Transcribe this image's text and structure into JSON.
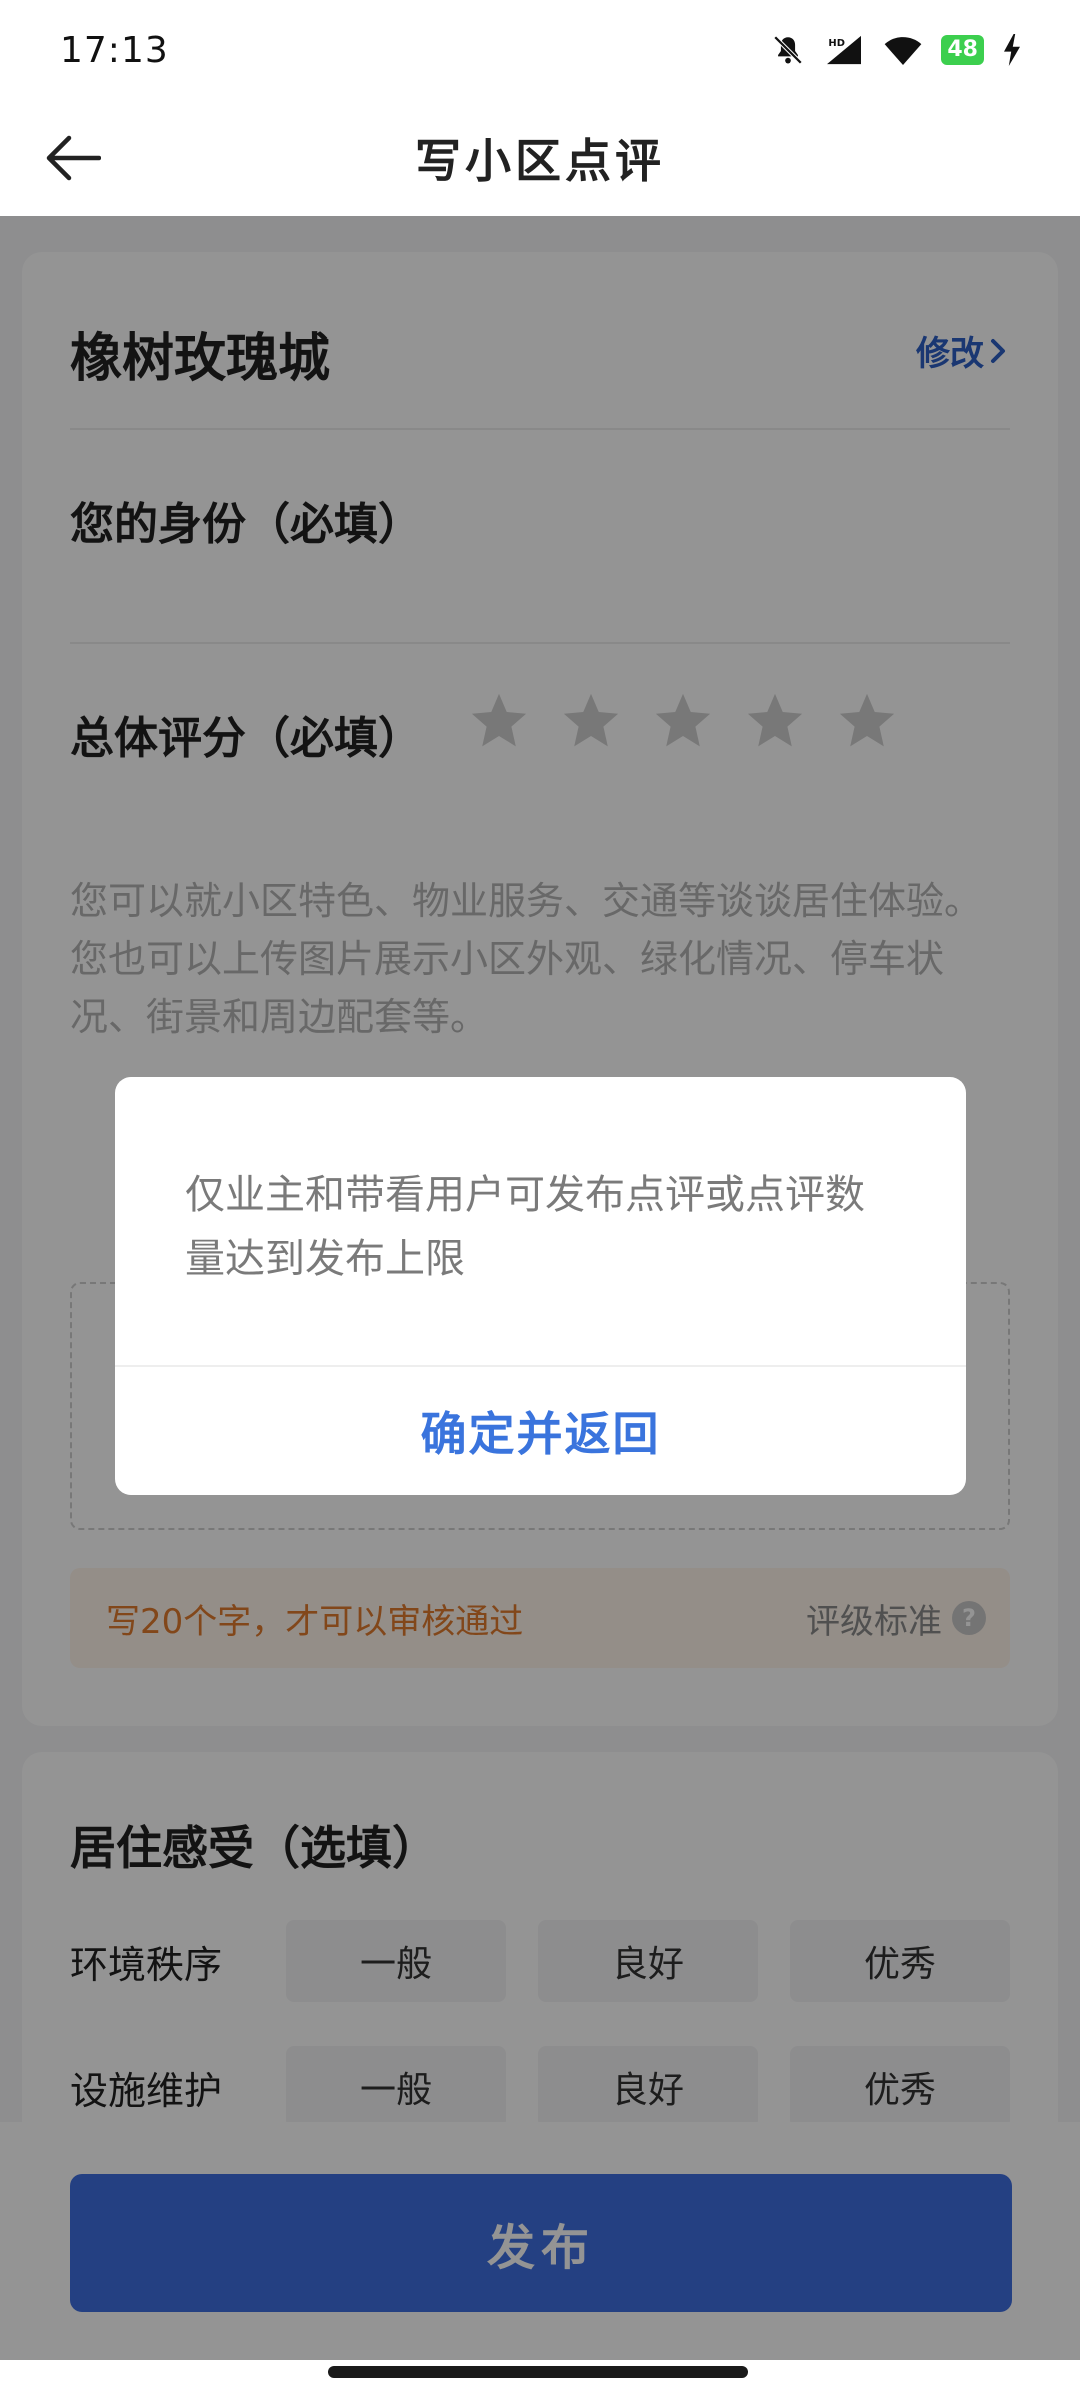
{
  "status_bar": {
    "time": "17:13",
    "battery": "48"
  },
  "header": {
    "title": "写小区点评"
  },
  "community": {
    "name": "橡树玫瑰城",
    "edit_label": "修改"
  },
  "identity": {
    "label": "您的身份（必填）"
  },
  "overall_rating": {
    "label": "总体评分（必填）",
    "stars": 5
  },
  "review": {
    "placeholder_line1": "您可以就小区特色、物业服务、交通等谈谈居住体验。",
    "placeholder_line2": "您也可以上传图片展示小区外观、绿化情况、停车状况、街景和周边配套等。"
  },
  "tip": {
    "text": "写20个字，才可以审核通过",
    "rating_standard": "评级标准"
  },
  "living": {
    "title": "居住感受（选填）",
    "rows": [
      {
        "label": "环境秩序",
        "options": [
          "一般",
          "良好",
          "优秀"
        ]
      },
      {
        "label": "设施维护",
        "options": [
          "一般",
          "良好",
          "优秀"
        ]
      }
    ]
  },
  "publish_button": "发布",
  "dialog": {
    "message": "仅业主和带看用户可发布点评或点评数量达到发布上限",
    "confirm_label": "确定并返回"
  },
  "colors": {
    "accent": "#3a74dd",
    "publish": "#3f6ee0",
    "tip_text": "#e07a2e",
    "tip_bg": "#fff4ea"
  }
}
